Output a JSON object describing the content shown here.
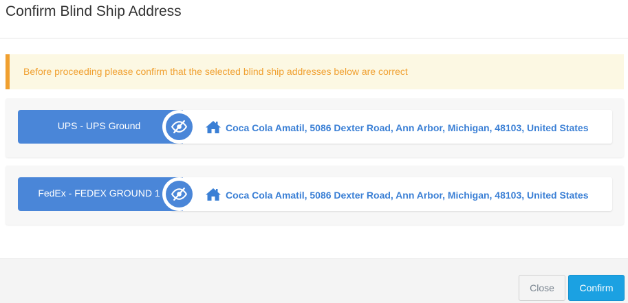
{
  "modal": {
    "title": "Confirm Blind Ship Address"
  },
  "alert": {
    "message": "Before proceeding please confirm that the selected blind ship addresses below are correct"
  },
  "shipments": [
    {
      "carrier": "UPS - UPS Ground",
      "address": "Coca Cola Amatil, 5086 Dexter Road, Ann Arbor, Michigan, 48103, United States",
      "toggle_icon": "eye-slash-icon",
      "address_icon": "home-icon"
    },
    {
      "carrier": "FedEx - FEDEX GROUND 1",
      "address": "Coca Cola Amatil, 5086 Dexter Road, Ann Arbor, Michigan, 48103, United States",
      "toggle_icon": "eye-slash-icon",
      "address_icon": "home-icon"
    }
  ],
  "footer": {
    "close_label": "Close",
    "confirm_label": "Confirm"
  },
  "colors": {
    "carrier_pill": "#4a86d8",
    "address_text": "#3a7fd5",
    "alert_text": "#f0a030",
    "alert_bg": "#fcf8e3",
    "confirm_button": "#1ba1e2"
  }
}
